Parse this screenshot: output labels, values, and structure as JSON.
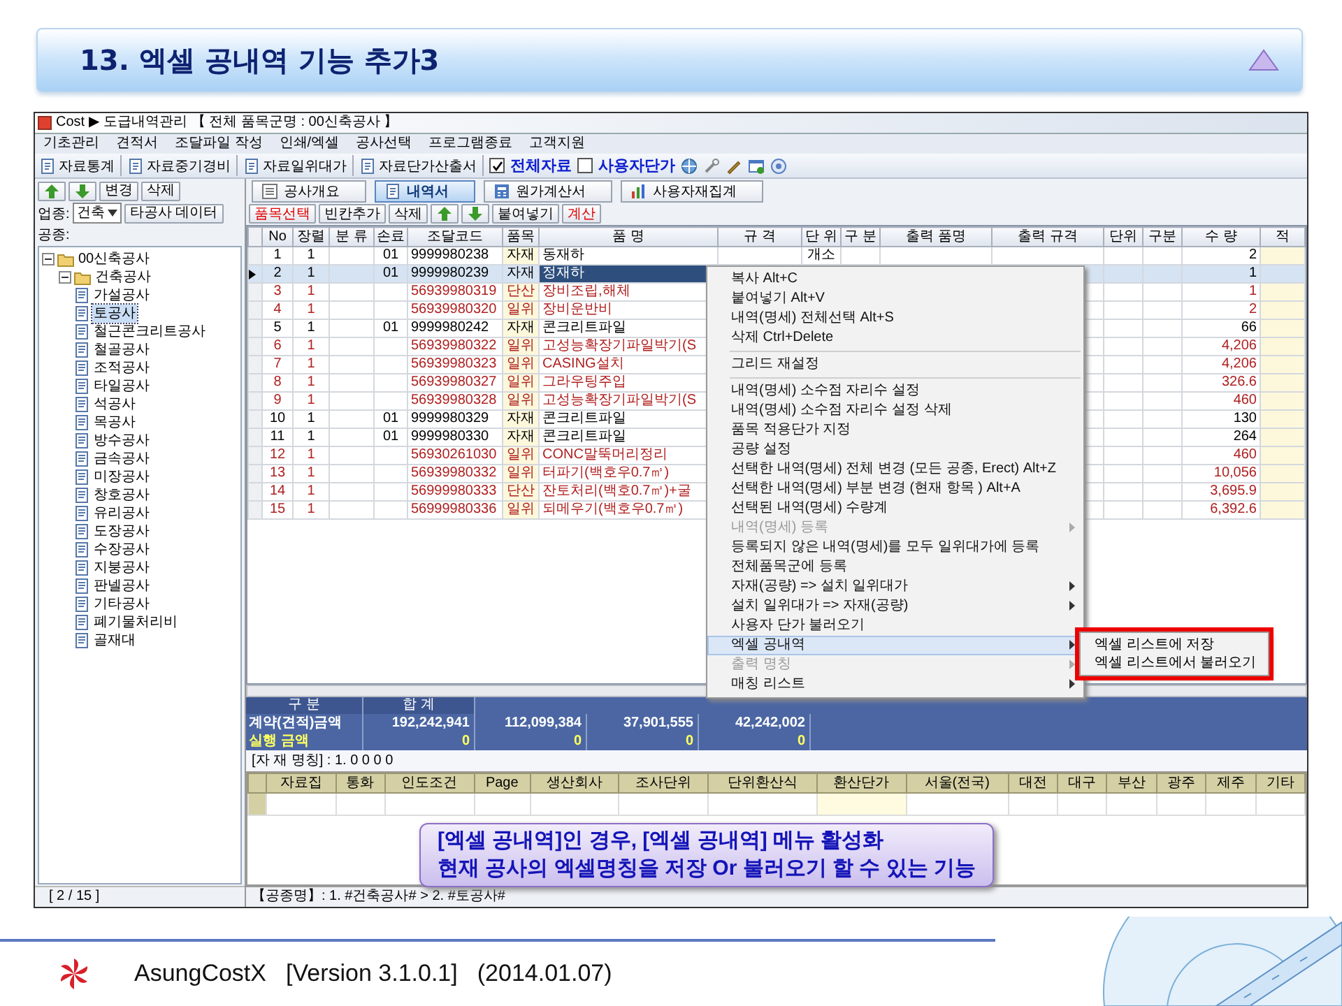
{
  "slide": {
    "title": "13. 엑셀 공내역 기능 추가3"
  },
  "app": {
    "title": "Cost ▶ 도급내역관리 【 전체 품목군명 : 00신축공사 】",
    "menu": [
      "기초관리",
      "견적서",
      "조달파일 작성",
      "인쇄/엑셀",
      "공사선택",
      "프로그램종료",
      "고객지원"
    ],
    "toolbar": [
      {
        "kind": "button",
        "label": "자료통계"
      },
      {
        "kind": "button",
        "label": "자료중기경비"
      },
      {
        "kind": "button",
        "label": "자료일위대가"
      },
      {
        "kind": "button",
        "label": "자료단가산출서"
      },
      {
        "kind": "check",
        "label": "전체자료",
        "checked": true
      },
      {
        "kind": "check",
        "label": "사용자단가",
        "checked": false
      }
    ],
    "left_panel": {
      "buttons": [
        {
          "kind": "up"
        },
        {
          "kind": "down"
        },
        {
          "kind": "text",
          "label": "변경"
        },
        {
          "kind": "text",
          "label": "삭제"
        }
      ],
      "trade_label": "업종:",
      "trade_value": "건축",
      "other_data_button": "타공사 데이터",
      "work_label": "공종:",
      "tree": [
        {
          "label": "00신축공사",
          "expanded": true,
          "selected": false,
          "children": [
            {
              "label": "건축공사",
              "expanded": true,
              "selected": false,
              "children": [
                {
                  "label": "가설공사",
                  "selected": false
                },
                {
                  "label": "토공사",
                  "selected": true
                },
                {
                  "label": "철근콘크리트공사",
                  "selected": false
                },
                {
                  "label": "철골공사",
                  "selected": false
                },
                {
                  "label": "조적공사",
                  "selected": false
                },
                {
                  "label": "타일공사",
                  "selected": false
                },
                {
                  "label": "석공사",
                  "selected": false
                },
                {
                  "label": "목공사",
                  "selected": false
                },
                {
                  "label": "방수공사",
                  "selected": false
                },
                {
                  "label": "금속공사",
                  "selected": false
                },
                {
                  "label": "미장공사",
                  "selected": false
                },
                {
                  "label": "창호공사",
                  "selected": false
                },
                {
                  "label": "유리공사",
                  "selected": false
                },
                {
                  "label": "도장공사",
                  "selected": false
                },
                {
                  "label": "수장공사",
                  "selected": false
                },
                {
                  "label": "지붕공사",
                  "selected": false
                },
                {
                  "label": "판넬공사",
                  "selected": false
                },
                {
                  "label": "기타공사",
                  "selected": false
                },
                {
                  "label": "폐기물처리비",
                  "selected": false
                },
                {
                  "label": "골재대",
                  "selected": false
                }
              ]
            }
          ]
        }
      ],
      "record_counter": "[ 2 / 15 ]"
    },
    "tabs": [
      {
        "label": "공사개요",
        "selected": false
      },
      {
        "label": "내역서",
        "selected": true
      },
      {
        "label": "원가계산서",
        "selected": false
      },
      {
        "label": "사용자재집계",
        "selected": false
      }
    ],
    "actions": [
      {
        "kind": "text",
        "label": "품목선택",
        "color": "#e00000"
      },
      {
        "kind": "text",
        "label": "빈칸추가",
        "color": "#000000"
      },
      {
        "kind": "text",
        "label": "삭제",
        "color": "#000000"
      },
      {
        "kind": "up"
      },
      {
        "kind": "down"
      },
      {
        "kind": "text",
        "label": "붙여넣기",
        "color": "#000000"
      },
      {
        "kind": "text",
        "label": "계산",
        "color": "#e00000"
      }
    ],
    "table": {
      "columns": [
        "No",
        "장렬",
        "분 류",
        "손료",
        "조달코드",
        "품목",
        "품 명",
        "규 격",
        "단 위",
        "구 분",
        "출력 품명",
        "출력 규격",
        "단위",
        "구분",
        "수 량",
        "적"
      ],
      "rows": [
        {
          "selected": false,
          "color": "#000000",
          "no": "1",
          "jangryeol": "1",
          "sonryo": "01",
          "code": "9999980238",
          "item": "자재",
          "name": "동재하",
          "unit": "개소",
          "qty": "2"
        },
        {
          "selected": true,
          "color": "#000000",
          "no": "2",
          "jangryeol": "1",
          "sonryo": "01",
          "code": "9999980239",
          "item": "자재",
          "name": "정재하",
          "qty": "1"
        },
        {
          "selected": false,
          "color": "#b02020",
          "no": "3",
          "jangryeol": "1",
          "code": "56939980319",
          "item": "단산",
          "name": "장비조립,해체",
          "qty": "1"
        },
        {
          "selected": false,
          "color": "#b02020",
          "no": "4",
          "jangryeol": "1",
          "code": "56939980320",
          "item": "일위",
          "name": "장비운반비",
          "qty": "2"
        },
        {
          "selected": false,
          "color": "#000000",
          "no": "5",
          "jangryeol": "1",
          "sonryo": "01",
          "code": "9999980242",
          "item": "자재",
          "name": "콘크리트파일",
          "qty": "66"
        },
        {
          "selected": false,
          "color": "#b02020",
          "no": "6",
          "jangryeol": "1",
          "code": "56939980322",
          "item": "일위",
          "name": "고성능확장기파일박기(S",
          "qty": "4,206"
        },
        {
          "selected": false,
          "color": "#b02020",
          "no": "7",
          "jangryeol": "1",
          "code": "56939980323",
          "item": "일위",
          "name": "CASING설치",
          "qty": "4,206"
        },
        {
          "selected": false,
          "color": "#b02020",
          "no": "8",
          "jangryeol": "1",
          "code": "56939980327",
          "item": "일위",
          "name": "그라우팅주입",
          "qty": "326.6"
        },
        {
          "selected": false,
          "color": "#b02020",
          "no": "9",
          "jangryeol": "1",
          "code": "56939980328",
          "item": "일위",
          "name": "고성능확장기파일박기(S",
          "qty": "460"
        },
        {
          "selected": false,
          "color": "#000000",
          "no": "10",
          "jangryeol": "1",
          "sonryo": "01",
          "code": "9999980329",
          "item": "자재",
          "name": "콘크리트파일",
          "qty": "130"
        },
        {
          "selected": false,
          "color": "#000000",
          "no": "11",
          "jangryeol": "1",
          "sonryo": "01",
          "code": "9999980330",
          "item": "자재",
          "name": "콘크리트파일",
          "qty": "264"
        },
        {
          "selected": false,
          "color": "#b02020",
          "no": "12",
          "jangryeol": "1",
          "code": "56930261030",
          "item": "일위",
          "name": "CONC말뚝머리정리",
          "qty": "460"
        },
        {
          "selected": false,
          "color": "#b02020",
          "no": "13",
          "jangryeol": "1",
          "code": "56939980332",
          "item": "일위",
          "name": "터파기(백호우0.7㎥)",
          "qty": "10,056"
        },
        {
          "selected": false,
          "color": "#b02020",
          "no": "14",
          "jangryeol": "1",
          "code": "56999980333",
          "item": "단산",
          "name": "잔토처리(백호0.7㎥)+굴",
          "qty": "3,695.9"
        },
        {
          "selected": false,
          "color": "#b02020",
          "no": "15",
          "jangryeol": "1",
          "code": "56999980336",
          "item": "일위",
          "name": "되메우기(백호우0.7㎥)",
          "qty": "6,392.6"
        }
      ]
    },
    "context_menu": {
      "items": [
        {
          "kind": "item",
          "label": "복사 Alt+C",
          "disabled": false,
          "submenu": false,
          "selected": false
        },
        {
          "kind": "item",
          "label": "붙여넣기 Alt+V",
          "disabled": false,
          "submenu": false,
          "selected": false
        },
        {
          "kind": "item",
          "label": "내역(명세) 전체선택 Alt+S",
          "disabled": false,
          "submenu": false,
          "selected": false
        },
        {
          "kind": "item",
          "label": "삭제 Ctrl+Delete",
          "disabled": false,
          "submenu": false,
          "selected": false
        },
        {
          "kind": "separator"
        },
        {
          "kind": "item",
          "label": "그리드 재설정",
          "disabled": false,
          "submenu": false,
          "selected": false
        },
        {
          "kind": "separator"
        },
        {
          "kind": "item",
          "label": "내역(명세) 소수점 자리수 설정",
          "disabled": false,
          "submenu": false,
          "selected": false
        },
        {
          "kind": "item",
          "label": "내역(명세) 소수점 자리수 설정 삭제",
          "disabled": false,
          "submenu": false,
          "selected": false
        },
        {
          "kind": "item",
          "label": "품목 적용단가 지정",
          "disabled": false,
          "submenu": false,
          "selected": false
        },
        {
          "kind": "item",
          "label": "공량 설정",
          "disabled": false,
          "submenu": false,
          "selected": false
        },
        {
          "kind": "item",
          "label": "선택한 내역(명세) 전체 변경 (모든 공종, Erect) Alt+Z",
          "disabled": false,
          "submenu": false,
          "selected": false
        },
        {
          "kind": "item",
          "label": "선택한 내역(명세) 부분 변경 (현재 항목 ) Alt+A",
          "disabled": false,
          "submenu": false,
          "selected": false
        },
        {
          "kind": "item",
          "label": "선택된 내역(명세) 수량계",
          "disabled": false,
          "submenu": false,
          "selected": false
        },
        {
          "kind": "item",
          "label": "내역(명세) 등록",
          "disabled": true,
          "submenu": true,
          "selected": false
        },
        {
          "kind": "item",
          "label": "등록되지 않은 내역(명세)를 모두 일위대가에 등록",
          "disabled": false,
          "submenu": false,
          "selected": false
        },
        {
          "kind": "item",
          "label": "전체품목군에 등록",
          "disabled": false,
          "submenu": false,
          "selected": false
        },
        {
          "kind": "item",
          "label": "자재(공량) => 설치 일위대가",
          "disabled": false,
          "submenu": true,
          "selected": false
        },
        {
          "kind": "item",
          "label": "설치 일위대가 => 자재(공량)",
          "disabled": false,
          "submenu": true,
          "selected": false
        },
        {
          "kind": "item",
          "label": "사용자 단가 불러오기",
          "disabled": false,
          "submenu": false,
          "selected": false
        },
        {
          "kind": "item",
          "label": "엑셀 공내역",
          "disabled": false,
          "submenu": true,
          "selected": true
        },
        {
          "kind": "item",
          "label": "출력 명칭",
          "disabled": true,
          "submenu": true,
          "selected": false
        },
        {
          "kind": "item",
          "label": "매칭 리스트",
          "disabled": false,
          "submenu": true,
          "selected": false
        }
      ]
    },
    "submenu": {
      "highlighted": true,
      "items": [
        "엑셀 리스트에 저장",
        "엑셀 리스트에서 불러오기"
      ]
    },
    "summary": {
      "headers": [
        "구 분",
        "합 계"
      ],
      "rows": [
        {
          "label": "계약(견적)금액",
          "kind": "contract",
          "values": [
            "192,242,941",
            "112,099,384",
            "37,901,555",
            "42,242,002"
          ]
        },
        {
          "label": "실행 금액",
          "kind": "actual",
          "values": [
            "0",
            "0",
            "0",
            "0"
          ]
        }
      ]
    },
    "material_name": "[자 재 명칭] : 1. 0 0 0 0",
    "price_grid": {
      "columns": [
        "자료집",
        "통화",
        "인도조건",
        "Page",
        "생산회사",
        "조사단위",
        "단위환산식",
        "환산단가",
        "서울(전국)",
        "대전",
        "대구",
        "부산",
        "광주",
        "제주",
        "기타"
      ]
    },
    "status": "【공종명】: 1. #건축공사# > 2. #토공사#"
  },
  "callout": {
    "lines": [
      "[엑셀 공내역]인 경우, [엑셀 공내역] 메뉴 활성화",
      "현재 공사의 엑셀명칭을 저장 Or 불러오기 할 수 있는 기능"
    ]
  },
  "footer": {
    "product": "AsungCostX",
    "version": "[Version 3.1.0.1]",
    "date": "(2014.01.07)"
  }
}
